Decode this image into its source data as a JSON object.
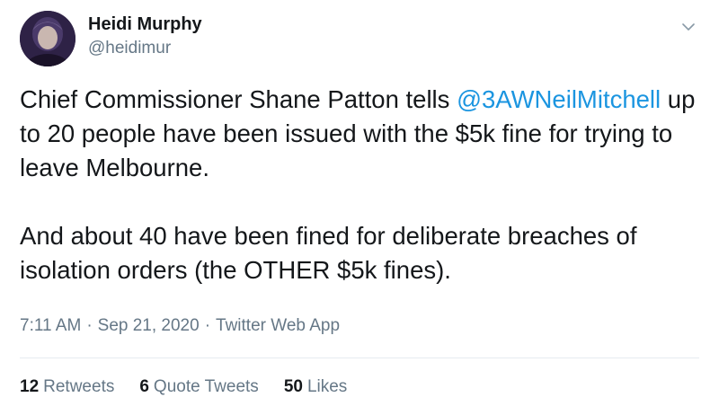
{
  "author": {
    "name": "Heidi Murphy",
    "handle": "@heidimur",
    "avatar_icon": "user-avatar"
  },
  "menu": {
    "icon": "chevron-down-icon"
  },
  "tweet": {
    "paragraph1": {
      "lead": "Chief Commissioner Shane Patton tells ",
      "mention": "@3AWNeilMitchell",
      "tail": " up to 20 people have been issued with the $5k fine for trying to leave Melbourne."
    },
    "paragraph2": "And about 40 have been fined for deliberate breaches of isolation orders (the OTHER $5k fines)."
  },
  "meta": {
    "time": "7:11 AM",
    "separator": "·",
    "date": "Sep 21, 2020",
    "source": "Twitter Web App"
  },
  "stats": {
    "retweets": {
      "count": "12",
      "label": "Retweets"
    },
    "quote_tweets": {
      "count": "6",
      "label": "Quote Tweets"
    },
    "likes": {
      "count": "50",
      "label": "Likes"
    }
  },
  "colors": {
    "link": "#1b95e0",
    "secondary_text": "#657786",
    "primary_text": "#14171a",
    "divider": "#e6ecf0"
  }
}
